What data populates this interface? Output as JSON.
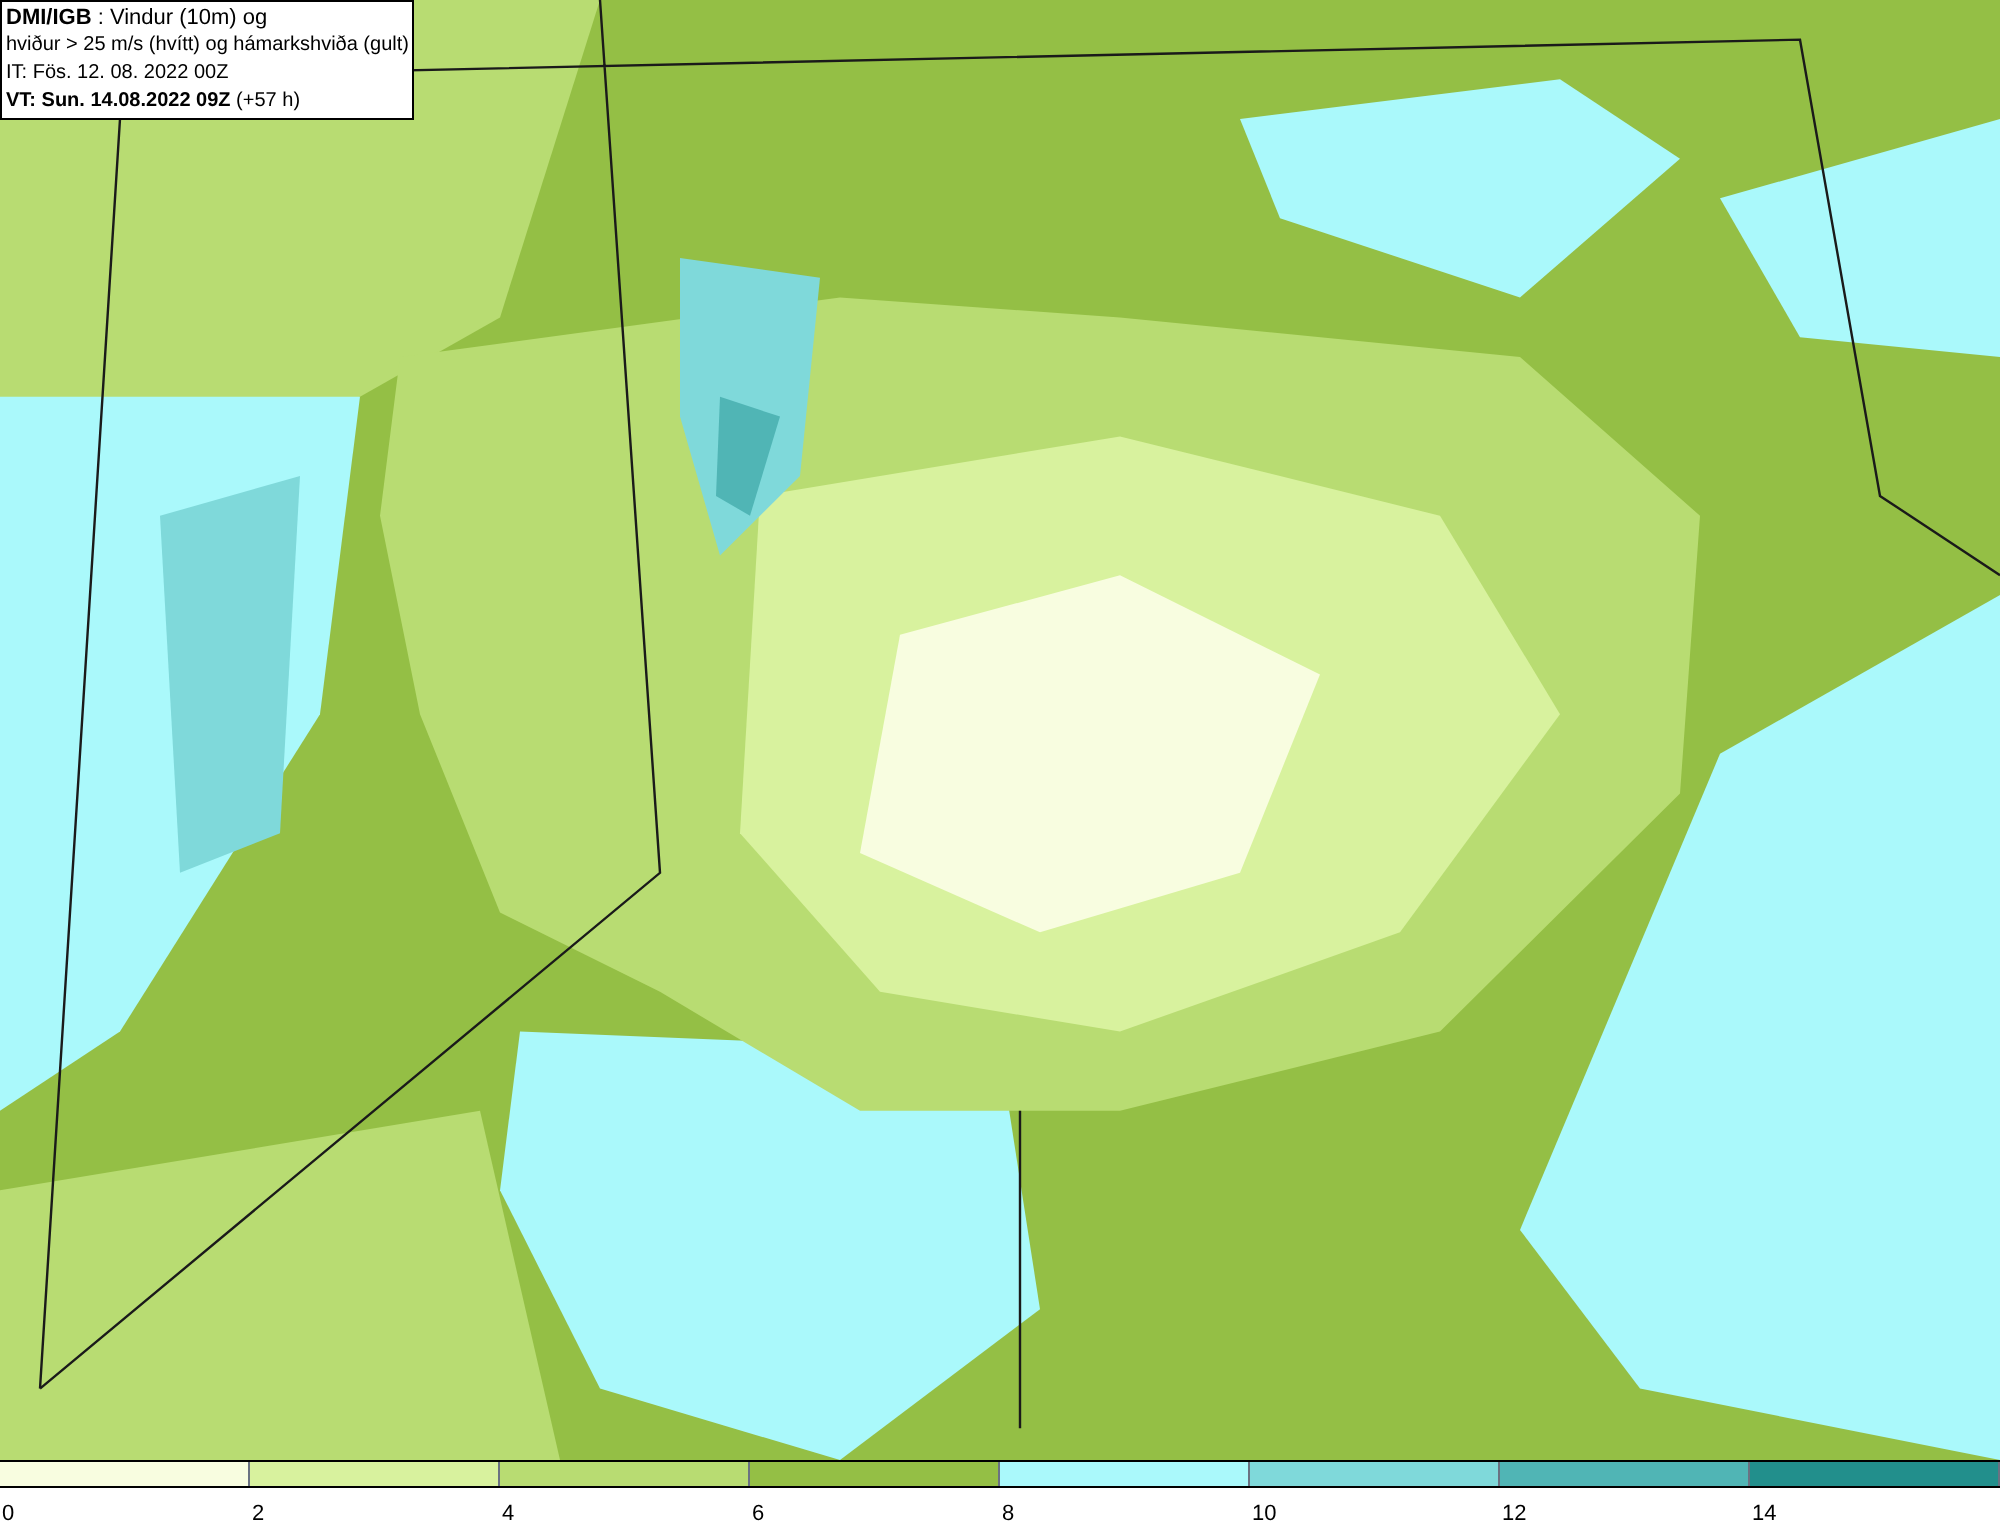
{
  "info_box": {
    "lines": [
      "**DMI/IGB** : Vindur (10m) og",
      "hviður > 25 m/s (hvítt) og hámarkshviða (gult)",
      "IT: Fös. 12. 08. 2022 00Z",
      "**VT: Sun. 14.08.2022 09Z** (+57 h)"
    ]
  },
  "legend": {
    "segments": [
      {
        "color": "#f8fde0",
        "label": "0"
      },
      {
        "color": "#d8f29e",
        "label": "2"
      },
      {
        "color": "#b8dc72",
        "label": "4"
      },
      {
        "color": "#94bf45",
        "label": "6"
      },
      {
        "color": "#aaf9fb",
        "label": "8"
      },
      {
        "color": "#7fd9da",
        "label": "10"
      },
      {
        "color": "#50b5b5",
        "label": "12"
      },
      {
        "color": "#228f8c",
        "label": "14"
      }
    ]
  }
}
